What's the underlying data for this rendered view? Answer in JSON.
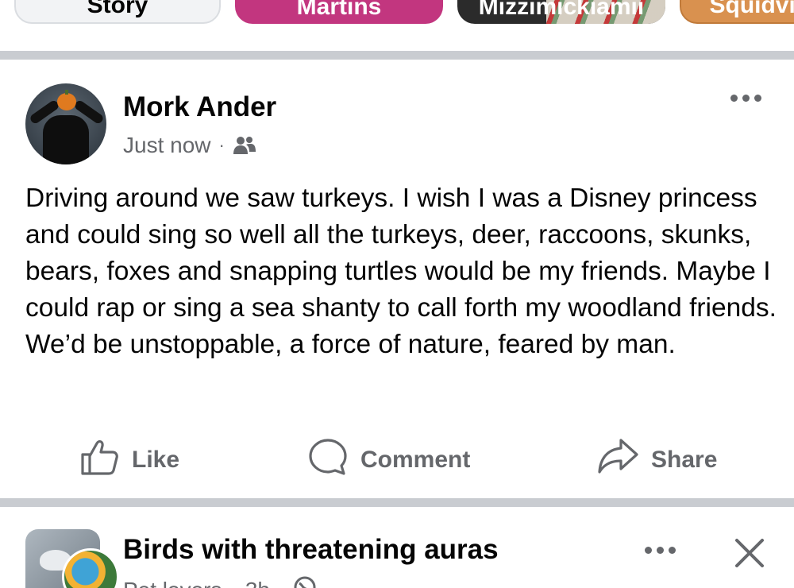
{
  "stories": [
    {
      "label": "Story"
    },
    {
      "label": "Martins"
    },
    {
      "label": "Mizzimickiamii"
    },
    {
      "label": "Squidvis"
    }
  ],
  "post": {
    "author": "Mork Ander",
    "timestamp": "Just now",
    "audience_icon": "friends-icon",
    "text": "Driving around we saw turkeys. I wish I was a Disney princess and could sing so well all the turkeys, deer, raccoons, skunks, bears, foxes and snapping turtles would be my friends. Maybe I could rap or sing a sea shanty to call forth my woodland friends. We’d be unstoppable, a force of nature, feared by man.",
    "actions": {
      "like": "Like",
      "comment": "Comment",
      "share": "Share"
    }
  },
  "next_post": {
    "group_name": "Birds with threatening auras",
    "poster": "Pet lovers",
    "time": "3h",
    "audience_icon": "globe-icon"
  },
  "colors": {
    "secondary_text": "#65676b",
    "divider": "#c9ccd1",
    "story_martins": "#c2367f",
    "story_squidvis": "#d9914f"
  }
}
